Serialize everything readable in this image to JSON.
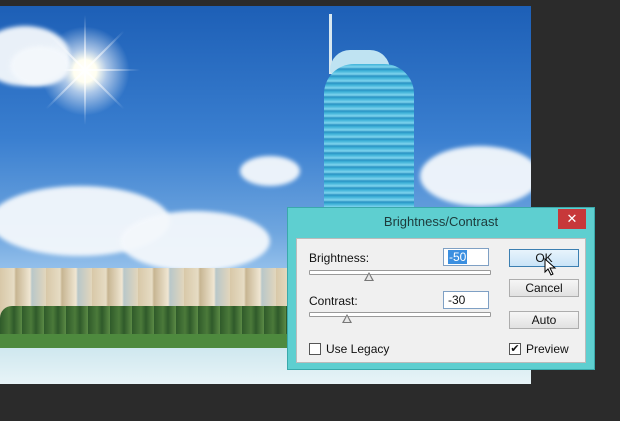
{
  "dialog": {
    "title": "Brightness/Contrast",
    "close_glyph": "✕",
    "brightness": {
      "label": "Brightness:",
      "value": "-50"
    },
    "contrast": {
      "label": "Contrast:",
      "value": "-30"
    },
    "use_legacy": {
      "label": "Use Legacy",
      "checked": false
    },
    "preview": {
      "label": "Preview",
      "checked": true,
      "mark": "✔"
    },
    "buttons": {
      "ok": "OK",
      "reset": "Cancel",
      "auto": "Auto"
    }
  },
  "icons": {
    "close": "close-icon",
    "cursor": "mouse-pointer-icon"
  },
  "colors": {
    "dialog_frame": "#5ecfd0",
    "close_button": "#c7383a",
    "selection": "#3b8fe0"
  }
}
